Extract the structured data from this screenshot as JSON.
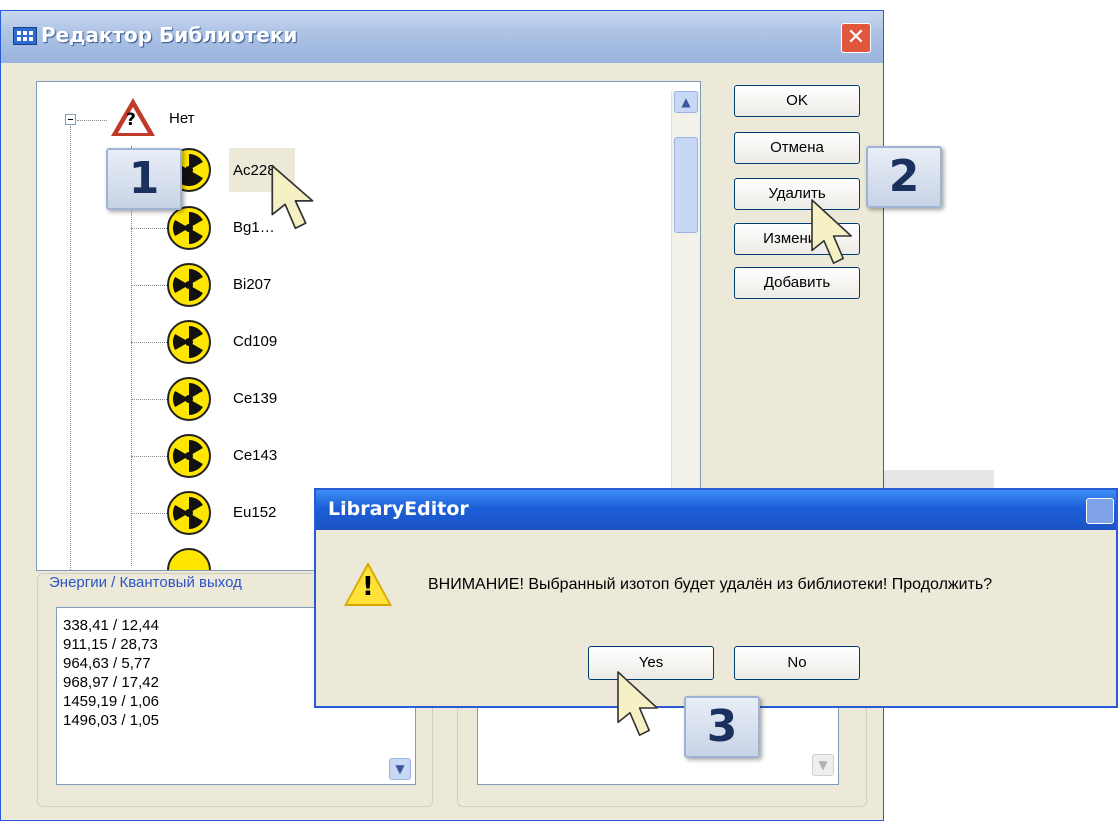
{
  "window": {
    "title": "Редактор Библиотеки",
    "close_label": "✕"
  },
  "tree": {
    "root": {
      "label": "Нет",
      "icon": "warning-question-icon"
    },
    "items": [
      {
        "label": "Ac228",
        "selected": true
      },
      {
        "label": "Bg1…"
      },
      {
        "label": "Bi207"
      },
      {
        "label": "Cd109"
      },
      {
        "label": "Ce139"
      },
      {
        "label": "Ce143"
      },
      {
        "label": "Eu152"
      }
    ],
    "item_icon": "radiation-icon"
  },
  "buttons": {
    "ok": "OK",
    "cancel": "Отмена",
    "delete": "Удалить",
    "edit": "Изменить",
    "add": "Добавить"
  },
  "energies": {
    "title": "Энергии / Квантовый выход",
    "lines": [
      "338,41 / 12,44",
      "911,15 / 28,73",
      "964,63 / 5,77",
      "968,97 / 17,42",
      "1459,19 / 1,06",
      "1496,03 / 1,05"
    ]
  },
  "dialog": {
    "title": "LibraryEditor",
    "message": "ВНИМАНИЕ! Выбранный изотоп будет удалён из библиотеки! Продолжить?",
    "yes": "Yes",
    "no": "No",
    "icon": "warning-icon"
  },
  "markers": {
    "m1": "1",
    "m2": "2",
    "m3": "3"
  },
  "colors": {
    "title_blue": "#1c5fd8",
    "window_bg": "#ece9d8",
    "radiation_yellow": "#ffe600",
    "warning_red": "#c0392b"
  }
}
